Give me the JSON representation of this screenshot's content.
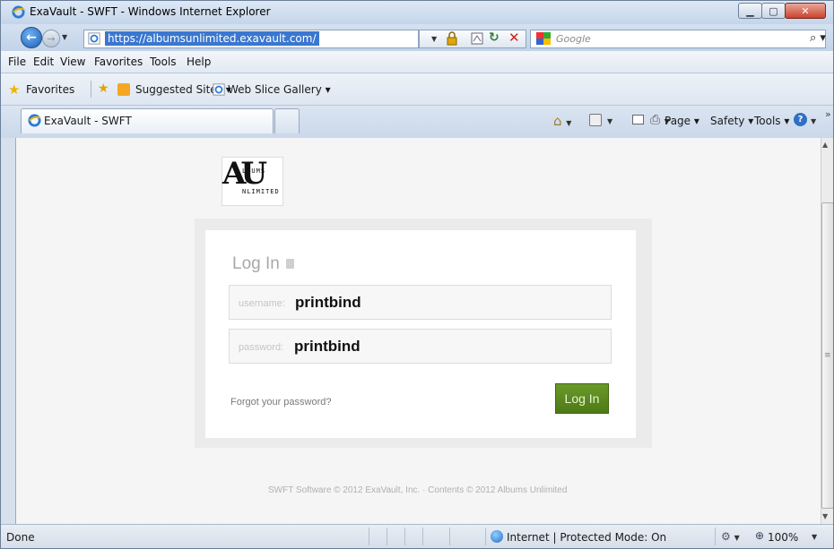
{
  "window": {
    "title": "ExaVault - SWFT - Windows Internet Explorer"
  },
  "address_bar": {
    "url": "https://albumsunlimited.exavault.com/"
  },
  "search": {
    "placeholder": "Google"
  },
  "menu": {
    "items": [
      "File",
      "Edit",
      "View",
      "Favorites",
      "Tools",
      "Help"
    ]
  },
  "favorites_bar": {
    "favorites_label": "Favorites",
    "suggested_sites": "Suggested Sites ▾",
    "web_slice_gallery": "Web Slice Gallery ▾"
  },
  "tabs": {
    "active_label": "ExaVault - SWFT"
  },
  "command_bar": {
    "page": "Page ▾",
    "safety": "Safety ▾",
    "tools": "Tools ▾"
  },
  "logo": {
    "letters": "AU",
    "line1": "LBUMS",
    "line2": "NLIMITED"
  },
  "login": {
    "heading": "Log In",
    "username_label": "username:",
    "username_value": "printbind",
    "password_label": "password:",
    "password_value": "printbind",
    "forgot_link": "Forgot your password?",
    "submit_label": "Log In"
  },
  "footer": {
    "text": "SWFT Software © 2012 ExaVault, Inc. · Contents © 2012 Albums Unlimited"
  },
  "status_bar": {
    "status": "Done",
    "zone": "Internet | Protected Mode: On",
    "zoom": "100%"
  },
  "colors": {
    "login_button": "#5a8a1f",
    "selection": "#3a77d0"
  }
}
